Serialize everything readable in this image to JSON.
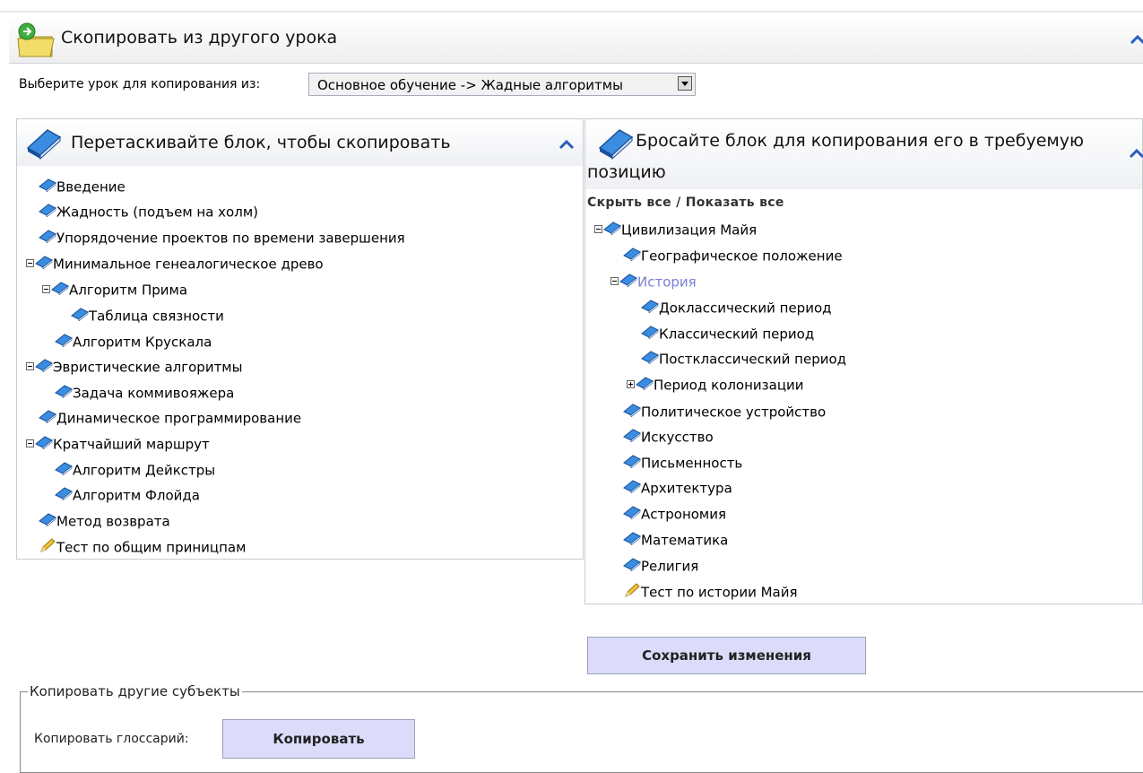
{
  "header": {
    "title": "Скопировать из другого урока"
  },
  "selector": {
    "label": "Выберите урок для копирования из:",
    "value": "Основное обучение -> Жадные алгоритмы"
  },
  "left_panel": {
    "title": "Перетаскивайте блок, чтобы скопировать",
    "items": [
      {
        "label": "Введение",
        "icon": "book-icon"
      },
      {
        "label": "Жадность (подъем на холм)",
        "icon": "book-icon"
      },
      {
        "label": "Упорядочение проектов по времени завершения",
        "icon": "book-icon"
      },
      {
        "label": "Минимальное генеалогическое древо",
        "icon": "book-icon"
      },
      {
        "label": "Алгоритм Прима",
        "icon": "book-icon"
      },
      {
        "label": "Таблица связности",
        "icon": "book-icon"
      },
      {
        "label": "Алгоритм Крускала",
        "icon": "book-icon"
      },
      {
        "label": "Эвристические алгоритмы",
        "icon": "book-icon"
      },
      {
        "label": "Задача коммивояжера",
        "icon": "book-icon"
      },
      {
        "label": "Динамическое программирование",
        "icon": "book-icon"
      },
      {
        "label": "Кратчайший маршрут",
        "icon": "book-icon"
      },
      {
        "label": "Алгоритм Дейкстры",
        "icon": "book-icon"
      },
      {
        "label": "Алгоритм Флойда",
        "icon": "book-icon"
      },
      {
        "label": "Метод возврата",
        "icon": "book-icon"
      },
      {
        "label": "Тест по общим приницпам",
        "icon": "pencil-icon"
      }
    ]
  },
  "right_panel": {
    "title_line1": "Бросайте блок для копирования его в требуемую",
    "title_line2": "позицию",
    "toggle_links": "Скрыть все / Показать все",
    "items": [
      {
        "label": "Цивилизация Майя",
        "icon": "book-icon"
      },
      {
        "label": "Географическое положение",
        "icon": "book-icon"
      },
      {
        "label": "История",
        "icon": "book-icon",
        "active_color": "#7b7fd6"
      },
      {
        "label": "Доклассический период",
        "icon": "book-icon"
      },
      {
        "label": "Классический период",
        "icon": "book-icon"
      },
      {
        "label": "Постклассический период",
        "icon": "book-icon"
      },
      {
        "label": "Период колонизации",
        "icon": "book-icon"
      },
      {
        "label": "Политическое устройство",
        "icon": "book-icon"
      },
      {
        "label": "Искусство",
        "icon": "book-icon"
      },
      {
        "label": "Письменность",
        "icon": "book-icon"
      },
      {
        "label": "Архитектура",
        "icon": "book-icon"
      },
      {
        "label": "Астрономия",
        "icon": "book-icon"
      },
      {
        "label": "Математика",
        "icon": "book-icon"
      },
      {
        "label": "Религия",
        "icon": "book-icon"
      },
      {
        "label": "Тест по истории Майя",
        "icon": "pencil-icon"
      }
    ]
  },
  "save_button": "Сохранить изменения",
  "other_subjects": {
    "legend": "Копировать другие субъекты",
    "glossary_label": "Копировать глоссарий:",
    "copy_button": "Копировать"
  },
  "colors": {
    "button_bg": "#dcdcfa",
    "accent_blue": "#2a6fd6",
    "active_link": "#7b7fd6"
  }
}
